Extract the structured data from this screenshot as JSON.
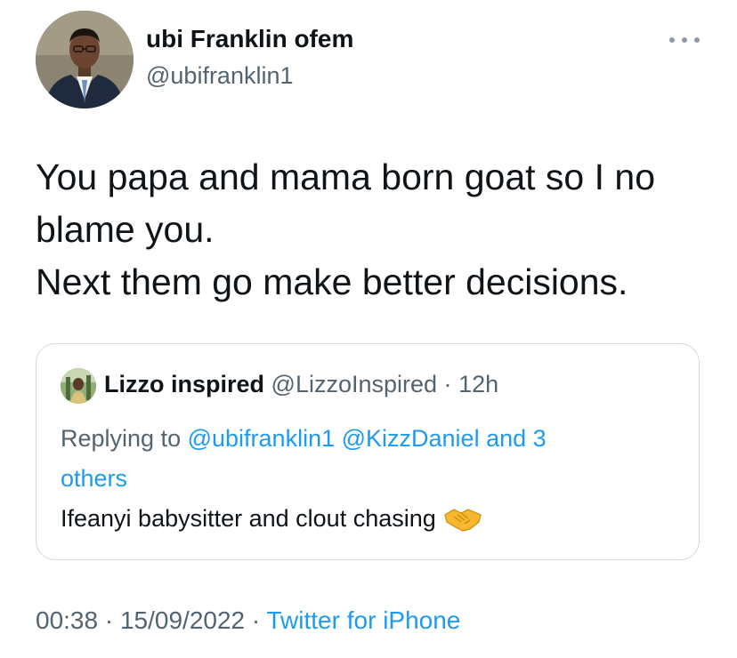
{
  "author": {
    "display_name": "ubi Franklin ofem",
    "handle": "@ubifranklin1",
    "avatar_icon": "profile-photo-avatar"
  },
  "more_icon": "more-options-icon",
  "tweet": {
    "lines": [
      "You papa and mama born goat so I no",
      "blame you.",
      "Next them go make better decisions."
    ]
  },
  "quote": {
    "display_name": "Lizzo inspired",
    "handle": "@LizzoInspired",
    "separator": "·",
    "time": "12h",
    "replying_prefix": "Replying to",
    "replying_to": "@ubifranklin1 @KizzDaniel and 3",
    "replying_rest": "others",
    "text": "Ifeanyi babysitter and clout chasing",
    "emoji_icon": "handshake-icon"
  },
  "footer": {
    "time": "00:38",
    "sep1": "·",
    "date": "15/09/2022",
    "sep2": "·",
    "source": "Twitter for iPhone"
  },
  "colors": {
    "text": "#0f1419",
    "secondary": "#536471",
    "link": "#1d9bf0",
    "border": "#cfd9de"
  }
}
